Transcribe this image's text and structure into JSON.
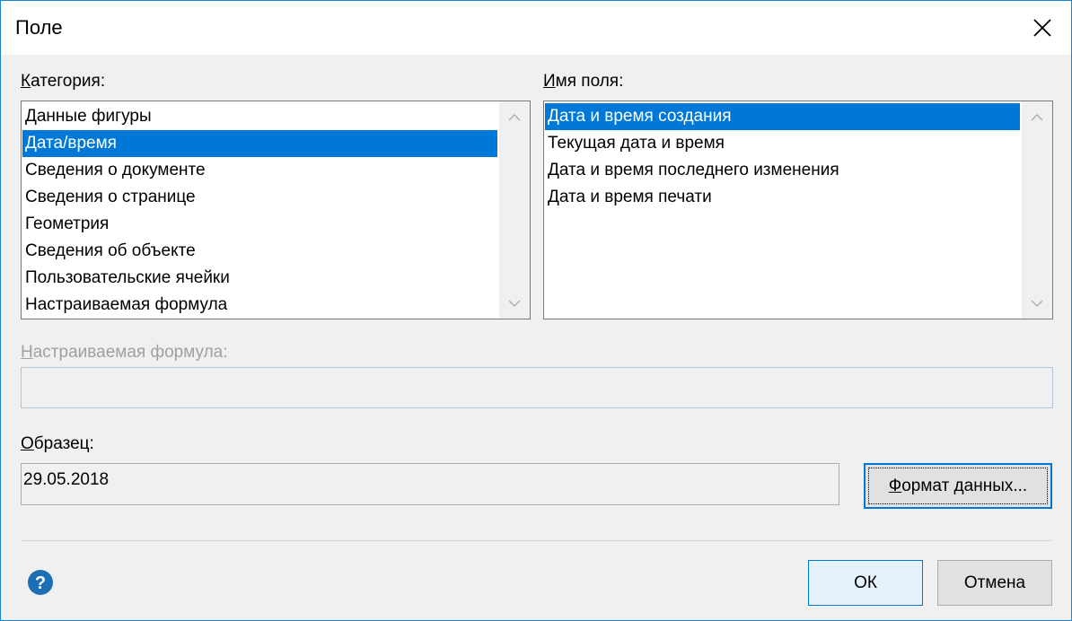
{
  "dialog": {
    "title": "Поле",
    "close_icon": "close-icon"
  },
  "category": {
    "label_accel": "К",
    "label_rest": "атегория:",
    "items": [
      {
        "label": "Данные фигуры",
        "selected": false
      },
      {
        "label": "Дата/время",
        "selected": true
      },
      {
        "label": "Сведения о документе",
        "selected": false
      },
      {
        "label": "Сведения о странице",
        "selected": false
      },
      {
        "label": "Геометрия",
        "selected": false
      },
      {
        "label": "Сведения об объекте",
        "selected": false
      },
      {
        "label": "Пользовательские ячейки",
        "selected": false
      },
      {
        "label": "Настраиваемая формула",
        "selected": false
      }
    ]
  },
  "field_name": {
    "label_accel": "И",
    "label_rest": "мя поля:",
    "items": [
      {
        "label": "Дата и время создания",
        "selected": true
      },
      {
        "label": "Текущая дата и время",
        "selected": false
      },
      {
        "label": "Дата и время последнего изменения",
        "selected": false
      },
      {
        "label": "Дата и время печати",
        "selected": false
      }
    ]
  },
  "custom_formula": {
    "label_accel": "Н",
    "label_rest": "астраиваемая формула:",
    "value": ""
  },
  "sample": {
    "label_accel": "О",
    "label_rest": "бразец:",
    "value": "29.05.2018"
  },
  "buttons": {
    "format_accel": "Ф",
    "format_rest": "ормат данных...",
    "ok": "ОК",
    "cancel": "Отмена",
    "help_icon": "help-icon"
  },
  "colors": {
    "accent": "#0078d7",
    "border": "#1883d7",
    "help": "#1c6eb5"
  }
}
